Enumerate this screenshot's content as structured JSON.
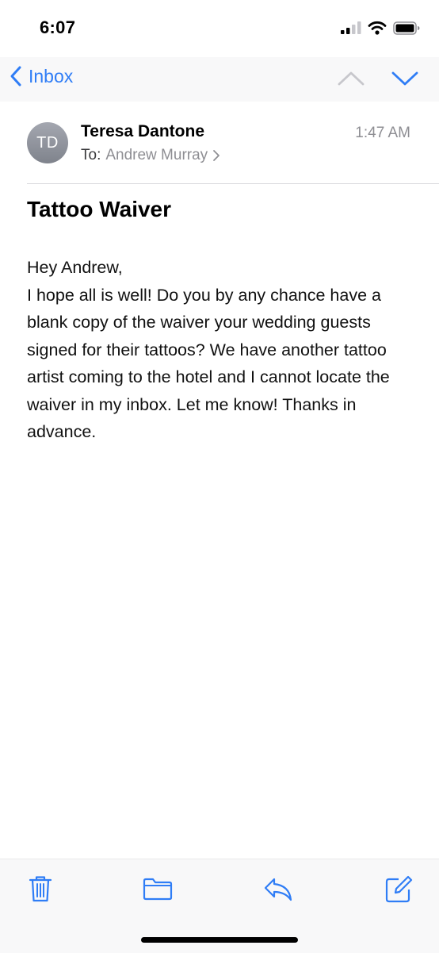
{
  "status_bar": {
    "time": "6:07",
    "icons": [
      "signal-icon",
      "wifi-icon",
      "battery-icon"
    ]
  },
  "nav": {
    "back_label": "Inbox",
    "icons": [
      "chevron-left-icon",
      "chevron-up-icon",
      "chevron-down-icon"
    ]
  },
  "message": {
    "avatar_initials": "TD",
    "sender": "Teresa Dantone",
    "to_label": "To:",
    "recipient": "Andrew Murray",
    "time": "1:47 AM",
    "subject": "Tattoo Waiver",
    "body": "Hey Andrew,\nI hope all is well! Do you by any chance have a blank copy of the waiver your wedding guests signed for their tattoos? We have another tattoo artist coming to the hotel and I cannot locate the waiver in my inbox. Let me know! Thanks in advance."
  },
  "toolbar": {
    "icons": [
      "trash-icon",
      "folder-icon",
      "reply-icon",
      "compose-icon"
    ]
  },
  "colors": {
    "accent": "#2f7df6",
    "secondary_text": "#8e8e93",
    "bar_background": "#f8f8f9"
  }
}
